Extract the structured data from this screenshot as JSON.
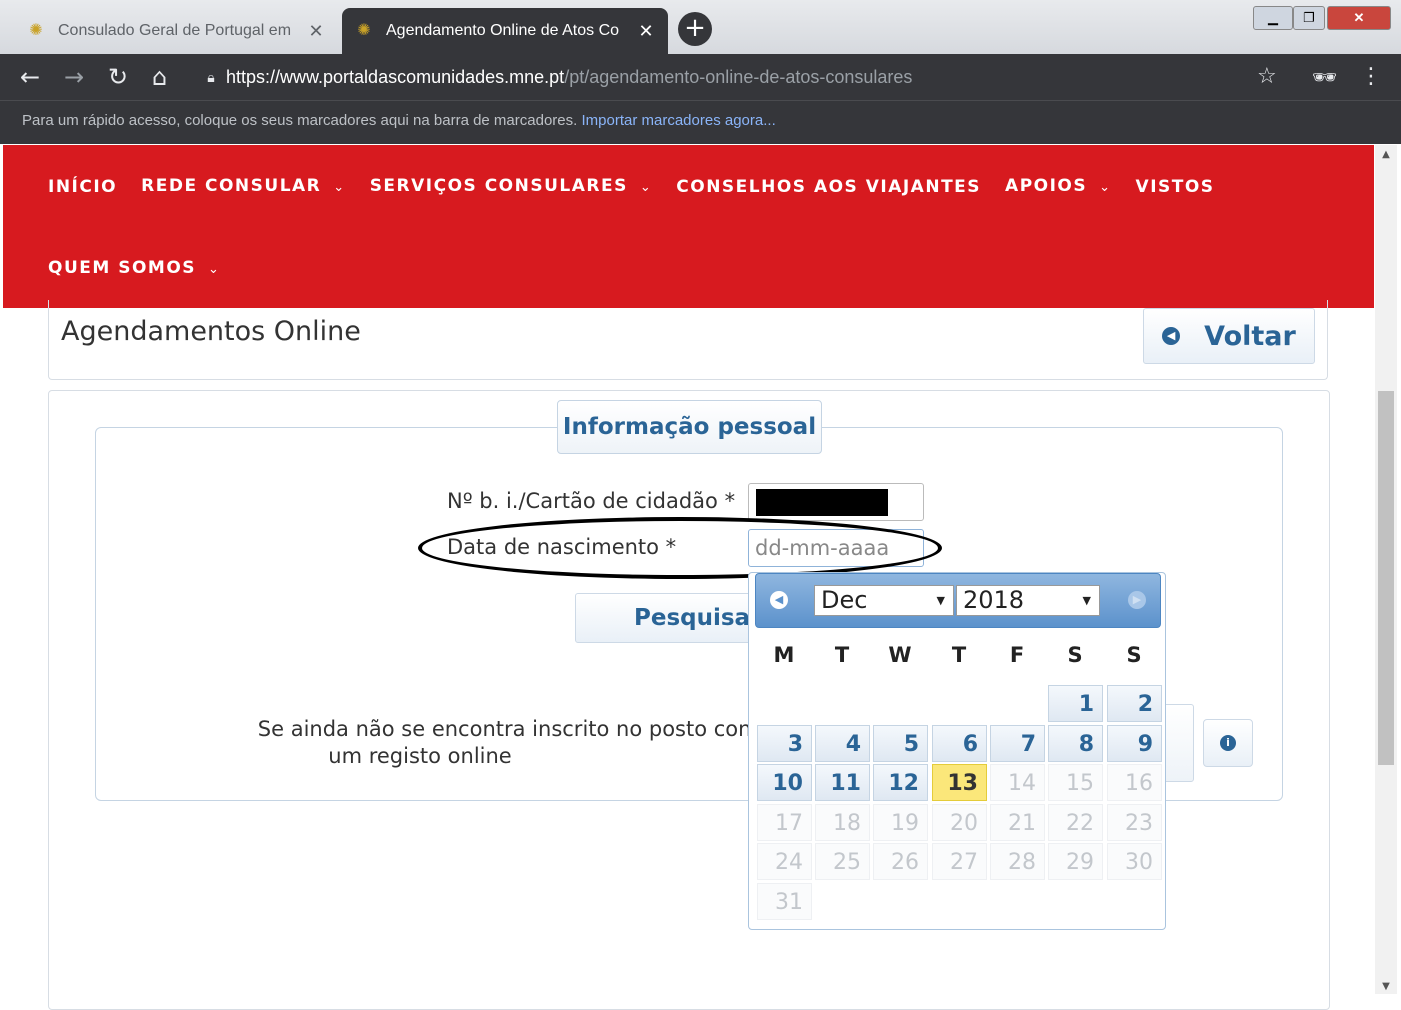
{
  "browser": {
    "tabs": [
      {
        "title": "Consulado Geral de Portugal em",
        "active": false
      },
      {
        "title": "Agendamento Online de Atos Co",
        "active": true
      }
    ],
    "new_tab_label": "+",
    "url_host": "https://www.portaldascomunidades.mne.pt",
    "url_path": "/pt/agendamento-online-de-atos-consulares",
    "bookmarks_bar_text": "Para um rápido acesso, coloque os seus marcadores aqui na barra de marcadores.",
    "bookmarks_bar_link": "Importar marcadores agora..."
  },
  "site_nav": {
    "items": [
      {
        "label": "INÍCIO",
        "dropdown": false
      },
      {
        "label": "REDE CONSULAR",
        "dropdown": true
      },
      {
        "label": "SERVIÇOS CONSULARES",
        "dropdown": true
      },
      {
        "label": "CONSELHOS AOS VIAJANTES",
        "dropdown": false
      },
      {
        "label": "APOIOS",
        "dropdown": true
      },
      {
        "label": "VISTOS",
        "dropdown": false
      },
      {
        "label": "QUEM SOMOS",
        "dropdown": true
      }
    ],
    "color": "#d71a1f"
  },
  "page": {
    "title": "Agendamentos Online",
    "back_button": "Voltar",
    "section_title": "Informação pessoal",
    "fields": {
      "id_label": "Nº b. i./Cartão de cidadão *",
      "id_value": "",
      "dob_label": "Data de nascimento *",
      "dob_placeholder": "dd-mm-aaaa"
    },
    "search_button": "Pesquisar",
    "info_line1": "Se ainda não se encontra inscrito no posto consular que de",
    "info_line2": "um registo online"
  },
  "datepicker": {
    "month": "Dec",
    "year": "2018",
    "weekdays": [
      "M",
      "T",
      "W",
      "T",
      "F",
      "S",
      "S"
    ],
    "today": "13",
    "weeks": [
      [
        "",
        "",
        "",
        "",
        "",
        "1",
        "2"
      ],
      [
        "3",
        "4",
        "5",
        "6",
        "7",
        "8",
        "9"
      ],
      [
        "10",
        "11",
        "12",
        "13",
        "14",
        "15",
        "16"
      ],
      [
        "17",
        "18",
        "19",
        "20",
        "21",
        "22",
        "23"
      ],
      [
        "24",
        "25",
        "26",
        "27",
        "28",
        "29",
        "30"
      ],
      [
        "31",
        "",
        "",
        "",
        "",
        "",
        ""
      ]
    ],
    "disabled_from": 14
  },
  "icons": {
    "favicon": "portugal-crest-icon",
    "back": "arrow-left-icon",
    "forward": "arrow-right-icon",
    "reload": "reload-icon",
    "home": "home-icon",
    "lock": "lock-icon",
    "star": "star-icon",
    "incognito": "incognito-icon",
    "menu": "kebab-menu-icon"
  }
}
